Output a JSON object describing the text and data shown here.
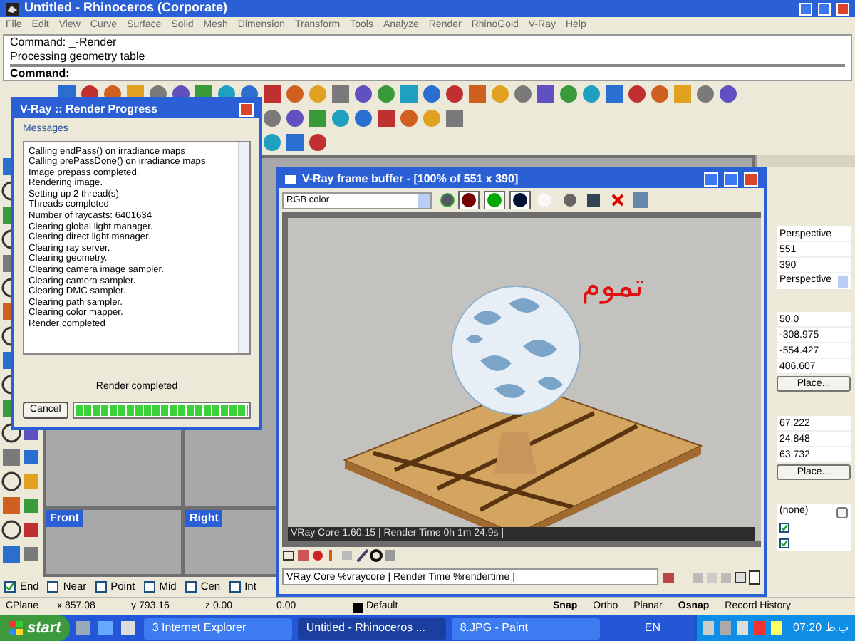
{
  "window": {
    "title": "Untitled - Rhinoceros (Corporate)"
  },
  "menu": [
    "File",
    "Edit",
    "View",
    "Curve",
    "Surface",
    "Solid",
    "Mesh",
    "Dimension",
    "Transform",
    "Tools",
    "Analyze",
    "Render",
    "RhinoGold",
    "V-Ray",
    "Help"
  ],
  "command_history": [
    "Command: _-Render",
    "Processing geometry table"
  ],
  "command_prompt": "Command:",
  "viewports": [
    {
      "label": "Front"
    },
    {
      "label": "Right"
    }
  ],
  "properties": [
    {
      "kind": "field",
      "value": "Perspective"
    },
    {
      "kind": "field",
      "value": "551"
    },
    {
      "kind": "field",
      "value": "390"
    },
    {
      "kind": "dropdown",
      "value": "Perspective"
    },
    {
      "kind": "gap"
    },
    {
      "kind": "field",
      "value": "50.0"
    },
    {
      "kind": "field",
      "value": "-308.975"
    },
    {
      "kind": "field",
      "value": "-554.427"
    },
    {
      "kind": "field",
      "value": "406.607"
    },
    {
      "kind": "button",
      "value": "Place..."
    },
    {
      "kind": "gap"
    },
    {
      "kind": "field",
      "value": "67.222"
    },
    {
      "kind": "field",
      "value": "24.848"
    },
    {
      "kind": "field",
      "value": "63.732"
    },
    {
      "kind": "button",
      "value": "Place..."
    },
    {
      "kind": "gap"
    },
    {
      "kind": "browse",
      "value": "(none)"
    },
    {
      "kind": "checkbox",
      "checked": true
    },
    {
      "kind": "checkbox",
      "checked": true
    }
  ],
  "render_progress": {
    "title": "V-Ray :: Render Progress",
    "group": "Messages",
    "messages": [
      "Calling endPass() on irradiance maps",
      "Calling prePassDone() on irradiance maps",
      "Image prepass completed.",
      "Rendering image.",
      "Setting up 2 thread(s)",
      "Threads completed",
      "Number of raycasts: 6401634",
      "Clearing global light manager.",
      "Clearing direct light manager.",
      "Clearing ray server.",
      "Clearing geometry.",
      "Clearing camera image sampler.",
      "Clearing camera sampler.",
      "Clearing DMC sampler.",
      "Clearing path sampler.",
      "Clearing color mapper.",
      "Render completed"
    ],
    "status": "Render completed",
    "cancel": "Cancel",
    "level": 1
  },
  "frame_buffer": {
    "title": "V-Ray frame buffer - [100% of 551 x 390]",
    "channel": "RGB color",
    "overlay_text": "تموم",
    "caption": "VRay Core 1.60.15 | Render Time 0h 1m 24.9s |",
    "stamp": "VRay Core %vraycore | Render Time %rendertime |"
  },
  "osnaps": [
    {
      "label": "End",
      "checked": true
    },
    {
      "label": "Near",
      "checked": false
    },
    {
      "label": "Point",
      "checked": false
    },
    {
      "label": "Mid",
      "checked": false
    },
    {
      "label": "Cen",
      "checked": false
    },
    {
      "label": "Int",
      "checked": false
    }
  ],
  "status_bar": {
    "cplane": "CPlane",
    "x": "x 857.08",
    "y": "y 793.16",
    "z": "z 0.00",
    "distance": "0.00",
    "layer": "Default",
    "toggles": [
      {
        "label": "Snap",
        "on": true
      },
      {
        "label": "Ortho",
        "on": false
      },
      {
        "label": "Planar",
        "on": false
      },
      {
        "label": "Osnap",
        "on": true
      },
      {
        "label": "Record History",
        "on": false
      }
    ]
  },
  "taskbar": {
    "start": "start",
    "tasks": [
      {
        "label": "3 Internet Explorer",
        "selected": false
      },
      {
        "label": "Untitled - Rhinoceros ...",
        "selected": true
      },
      {
        "label": "8.JPG - Paint",
        "selected": false
      }
    ],
    "language": "EN",
    "clock": "07:20 ب.ظ"
  }
}
